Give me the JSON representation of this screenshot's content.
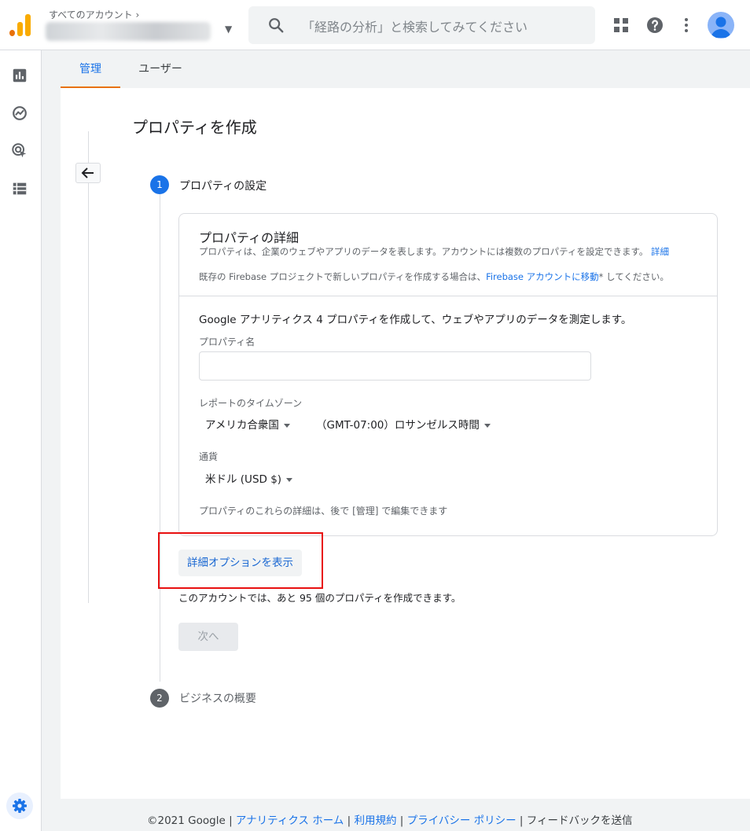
{
  "header": {
    "breadcrumb": "すべてのアカウント ›",
    "search_placeholder": "「経路の分析」と検索してみてください",
    "icons": {
      "apps": "apps-grid-icon",
      "help": "help-icon",
      "more": "more-vert-icon",
      "account": "account-avatar"
    }
  },
  "rail": {
    "items": [
      "reports-icon",
      "explore-icon",
      "advertising-icon",
      "configure-icon"
    ],
    "settings": "settings-gear-icon"
  },
  "tabs": [
    "管理",
    "ユーザー"
  ],
  "page": {
    "title": "プロパティを作成",
    "steps": [
      {
        "number": "1",
        "label": "プロパティの設定"
      },
      {
        "number": "2",
        "label": "ビジネスの概要"
      }
    ]
  },
  "card": {
    "title": "プロパティの詳細",
    "desc_main": "プロパティは、企業のウェブやアプリのデータを表します。アカウントには複数のプロパティを設定できます。",
    "desc_link": "詳細",
    "fb_prefix": "既存の Firebase プロジェクトで新しいプロパティを作成する場合は、",
    "fb_link": "Firebase アカウントに移動",
    "fb_suffix": "* してください。",
    "intro": "Google アナリティクス 4 プロパティを作成して、ウェブやアプリのデータを測定します。",
    "property_name_label": "プロパティ名",
    "property_name_value": "",
    "timezone_label": "レポートのタイムゾーン",
    "country": "アメリカ合衆国",
    "timezone": "（GMT-07:00）ロサンゼルス時間",
    "currency_label": "通貨",
    "currency": "米ドル (USD $)",
    "note": "プロパティのこれらの詳細は、後で [管理] で編集できます"
  },
  "advanced_button": "詳細オプションを表示",
  "quota_text": "このアカウントでは、あと 95 個のプロパティを作成できます。",
  "next_button": "次へ",
  "footer": {
    "copyright": "©2021 Google",
    "links": [
      "アナリティクス ホーム",
      "利用規約",
      "プライバシー ポリシー"
    ],
    "feedback": "フィードバックを送信"
  },
  "colors": {
    "accent": "#1a73e8",
    "tab_indicator": "#e8710a",
    "highlight": "#e81010"
  }
}
